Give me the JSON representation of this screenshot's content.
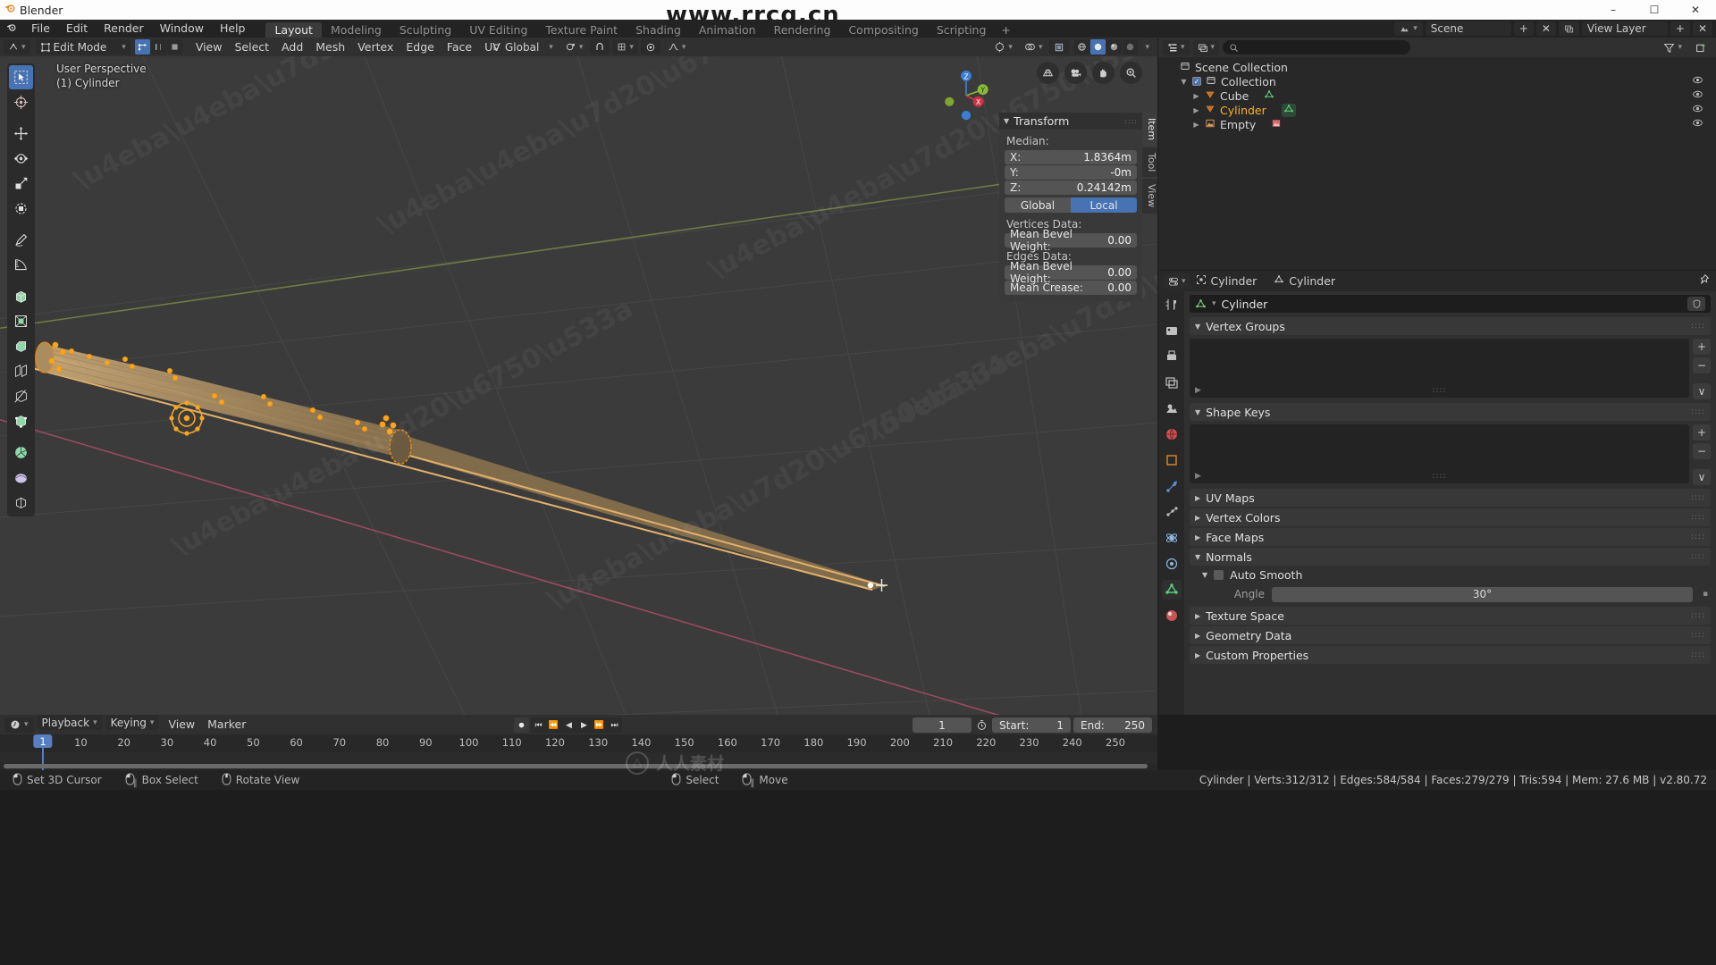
{
  "window": {
    "app_title": "Blender",
    "min_label": "–",
    "max_label": "☐",
    "close_label": "✕",
    "watermark_top": "www.rrcg.cn",
    "watermark_bottom": "人人素材"
  },
  "menu": {
    "items": [
      "File",
      "Edit",
      "Render",
      "Window",
      "Help"
    ]
  },
  "workspace_tabs": [
    {
      "label": "Layout",
      "active": true
    },
    {
      "label": "Modeling",
      "active": false
    },
    {
      "label": "Sculpting",
      "active": false
    },
    {
      "label": "UV Editing",
      "active": false
    },
    {
      "label": "Texture Paint",
      "active": false
    },
    {
      "label": "Shading",
      "active": false
    },
    {
      "label": "Animation",
      "active": false
    },
    {
      "label": "Rendering",
      "active": false
    },
    {
      "label": "Compositing",
      "active": false
    },
    {
      "label": "Scripting",
      "active": false
    },
    {
      "label": "+",
      "active": false
    }
  ],
  "topbar_right": {
    "scene_name": "Scene",
    "view_layer_name": "View Layer"
  },
  "viewport_header": {
    "mode": "Edit Mode",
    "menus": [
      "View",
      "Select",
      "Add",
      "Mesh",
      "Vertex",
      "Edge",
      "Face",
      "UV"
    ],
    "orientation": "Global",
    "pivot": "pivot-icon",
    "snap": "snap-icon",
    "proportional": "proportional-icon"
  },
  "viewport": {
    "perspective_label": "User Perspective",
    "object_label": "(1) Cylinder",
    "gizmo_axes": [
      "Z",
      "Y",
      "X"
    ],
    "nav_icons": [
      "grid-icon",
      "camera-icon",
      "hand-icon",
      "zoom-icon"
    ]
  },
  "toolbar": {
    "tools": [
      {
        "name": "tweak-select-box",
        "active": true
      },
      {
        "name": "cursor",
        "active": false
      },
      {
        "name": "move",
        "active": false
      },
      {
        "name": "rotate",
        "active": false
      },
      {
        "name": "scale",
        "active": false
      },
      {
        "name": "transform",
        "active": false
      },
      {
        "name": "annotate",
        "active": false
      },
      {
        "name": "measure",
        "active": false
      },
      {
        "name": "extrude-region",
        "active": false
      },
      {
        "name": "inset-faces",
        "active": false
      },
      {
        "name": "bevel",
        "active": false
      },
      {
        "name": "loop-cut",
        "active": false
      },
      {
        "name": "knife",
        "active": false
      },
      {
        "name": "poly-build",
        "active": false
      },
      {
        "name": "spin",
        "active": false
      },
      {
        "name": "smooth",
        "active": false
      },
      {
        "name": "shrink-fatten",
        "active": false
      }
    ]
  },
  "transform_panel": {
    "title": "Transform",
    "median_label": "Median:",
    "rows": [
      {
        "key": "X:",
        "value": "1.8364m"
      },
      {
        "key": "Y:",
        "value": "-0m"
      },
      {
        "key": "Z:",
        "value": "0.24142m"
      }
    ],
    "space_options": [
      {
        "label": "Global",
        "active": false
      },
      {
        "label": "Local",
        "active": true
      }
    ],
    "vertices_data_label": "Vertices Data:",
    "vertices_rows": [
      {
        "key": "Mean Bevel Weight:",
        "value": "0.00"
      }
    ],
    "edges_data_label": "Edges Data:",
    "edges_rows": [
      {
        "key": "Mean Bevel Weight:",
        "value": "0.00"
      },
      {
        "key": "Mean Crease:",
        "value": "0.00"
      }
    ],
    "side_tabs": [
      {
        "label": "Item",
        "active": true
      },
      {
        "label": "Tool",
        "active": false
      },
      {
        "label": "View",
        "active": false
      }
    ]
  },
  "outliner": {
    "search_placeholder": "",
    "display_mode_icon": "outliner-icon",
    "filter_icon": "filter-icon",
    "new_collection_icon": "new-collection-icon",
    "root": "Scene Collection",
    "rows": [
      {
        "label": "Collection",
        "indent": 1,
        "icon": "collection-icon",
        "checkbox": true,
        "selected": false,
        "eye": true,
        "expand": "▼"
      },
      {
        "label": "Cube",
        "indent": 2,
        "icon": "object-mesh-icon",
        "data_icon": "mesh-data-icon",
        "selected": false,
        "eye": true,
        "expand": "▶"
      },
      {
        "label": "Cylinder",
        "indent": 2,
        "icon": "object-mesh-icon",
        "data_icon": "mesh-data-icon",
        "selected": true,
        "eye": true,
        "expand": "▶"
      },
      {
        "label": "Empty",
        "indent": 2,
        "icon": "empty-image-icon",
        "data_icon": "image-data-icon",
        "selected": false,
        "eye": true,
        "expand": "▶"
      }
    ]
  },
  "properties": {
    "breadcrumb": [
      {
        "label": "Cylinder",
        "icon": "object-icon"
      },
      {
        "label": "Cylinder",
        "icon": "mesh-data-icon"
      }
    ],
    "pin_icon": "pin-icon",
    "datablock_name": "Cylinder",
    "tabs": [
      {
        "name": "tool-tab",
        "active": false
      },
      {
        "name": "render-tab",
        "active": false
      },
      {
        "name": "output-tab",
        "active": false
      },
      {
        "name": "view-layer-tab",
        "active": false
      },
      {
        "name": "scene-tab",
        "active": false
      },
      {
        "name": "world-tab",
        "active": false
      },
      {
        "name": "object-tab",
        "active": false
      },
      {
        "name": "modifier-tab",
        "active": false
      },
      {
        "name": "particles-tab",
        "active": false
      },
      {
        "name": "physics-tab",
        "active": false
      },
      {
        "name": "constraints-tab",
        "active": false
      },
      {
        "name": "object-data-tab",
        "active": true
      },
      {
        "name": "material-tab",
        "active": false
      }
    ],
    "panels": [
      {
        "label": "Vertex Groups",
        "open": true,
        "has_list": true
      },
      {
        "label": "Shape Keys",
        "open": true,
        "has_list": true
      },
      {
        "label": "UV Maps",
        "open": false,
        "has_list": false
      },
      {
        "label": "Vertex Colors",
        "open": false,
        "has_list": false
      },
      {
        "label": "Face Maps",
        "open": false,
        "has_list": false
      },
      {
        "label": "Normals",
        "open": true,
        "has_list": false
      },
      {
        "label": "Texture Space",
        "open": false,
        "has_list": false
      },
      {
        "label": "Geometry Data",
        "open": false,
        "has_list": false
      },
      {
        "label": "Custom Properties",
        "open": false,
        "has_list": false
      }
    ],
    "auto_smooth_label": "Auto Smooth",
    "angle_label": "Angle",
    "angle_value": "30°"
  },
  "timeline": {
    "menus": [
      "Playback",
      "Keying",
      "View",
      "Marker"
    ],
    "current_frame": "1",
    "start_label": "Start:",
    "start_value": "1",
    "end_label": "End:",
    "end_value": "250",
    "ticks": [
      10,
      20,
      30,
      40,
      50,
      60,
      70,
      80,
      90,
      100,
      110,
      120,
      130,
      140,
      150,
      160,
      170,
      180,
      190,
      200,
      210,
      220,
      230,
      240,
      250
    ],
    "playhead_frame": "1",
    "transport": [
      "jump-start",
      "prev-keyframe",
      "play-reverse",
      "play",
      "next-keyframe",
      "jump-end"
    ],
    "record_icon": "record-icon",
    "auto_key_icon": "auto-key-icon"
  },
  "status_bar": {
    "left_items": [
      {
        "mouse": "left",
        "label": "Set 3D Cursor"
      },
      {
        "mouse": "left-drag",
        "label": "Box Select"
      },
      {
        "mouse": "middle",
        "label": "Rotate View"
      }
    ],
    "mid_items": [
      {
        "mouse": "left",
        "label": "Select"
      },
      {
        "mouse": "left-drag",
        "label": "Move"
      }
    ],
    "stats": "Cylinder | Verts:312/312 | Edges:584/584 | Faces:279/279 | Tris:594 | Mem: 27.6 MB | v2.80.72"
  },
  "colors": {
    "accent_blue": "#4772b3",
    "selected_orange": "#ffaf29",
    "mesh_green": "#5ad17c",
    "axis_x_red": "#cc3344",
    "axis_y_green": "#88bb33",
    "axis_z_blue": "#3b7fd4"
  }
}
